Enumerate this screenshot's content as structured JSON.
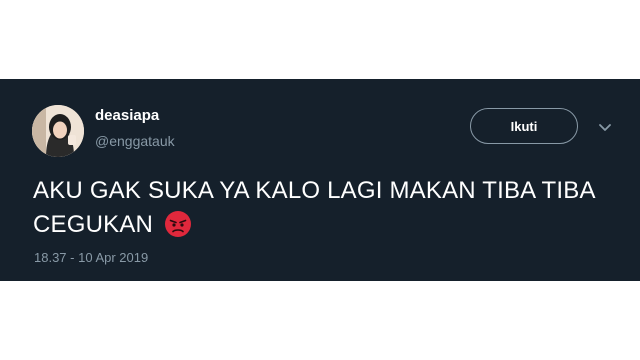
{
  "tweet": {
    "author": {
      "display_name": "deasiapa",
      "handle": "@enggatauk"
    },
    "follow_label": "Ikuti",
    "text": "AKU GAK SUKA YA KALO LAGI MAKAN TIBA TIBA CEGUKAN",
    "emoji": "angry-face-icon",
    "timestamp": "18.37 - 10 Apr 2019"
  },
  "colors": {
    "card_background": "#15202b",
    "text_primary": "#ffffff",
    "text_secondary": "#8899a6",
    "emoji_red": "#e0283c"
  }
}
